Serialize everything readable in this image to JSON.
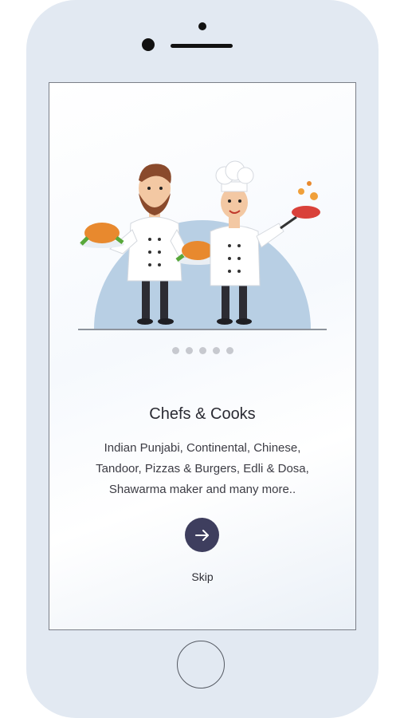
{
  "onboarding": {
    "title": "Chefs & Cooks",
    "description_lines": [
      "Indian Punjabi, Continental, Chinese,",
      "Tandoor, Pizzas & Burgers, Edli & Dosa,",
      "Shawarma maker and many more.."
    ],
    "skip_label": "Skip",
    "next_icon": "arrow-right-icon",
    "pagination": {
      "total": 5,
      "active": 1
    },
    "illustration": "two-chefs-illustration"
  },
  "colors": {
    "button_bg": "#3e3e5e",
    "dot_inactive": "#c7c9cf",
    "illustration_bg": "#b8cfe4",
    "phone_body": "#e2e9f2"
  }
}
